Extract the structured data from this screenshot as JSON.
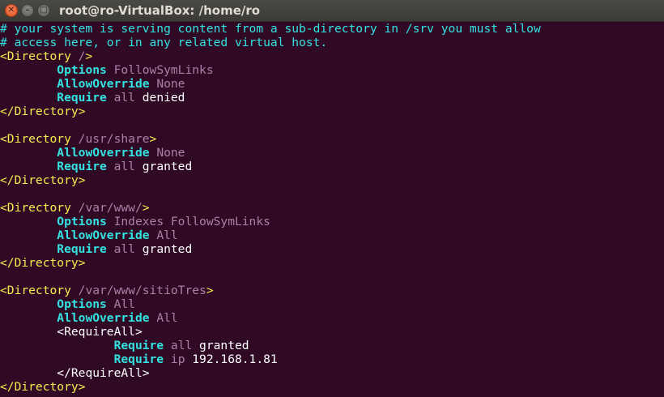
{
  "window": {
    "title": "root@ro-VirtualBox: /home/ro",
    "close_glyph": "✕",
    "minimize_glyph": "–",
    "maximize_glyph": "□"
  },
  "terminal": {
    "lines": [
      {
        "indent": "",
        "parts": [
          {
            "cls": "c",
            "text": "# your system is serving content from a sub-directory in /srv you must allow"
          }
        ]
      },
      {
        "indent": "",
        "parts": [
          {
            "cls": "c",
            "text": "# access here, or in any related virtual host."
          }
        ]
      },
      {
        "indent": "",
        "parts": [
          {
            "cls": "t",
            "text": "<Directory "
          },
          {
            "cls": "p",
            "text": "/"
          },
          {
            "cls": "t",
            "text": ">"
          }
        ]
      },
      {
        "indent": "        ",
        "parts": [
          {
            "cls": "k",
            "text": "Options"
          },
          {
            "cls": "w",
            "text": " "
          },
          {
            "cls": "p",
            "text": "FollowSymLinks"
          }
        ]
      },
      {
        "indent": "        ",
        "parts": [
          {
            "cls": "k",
            "text": "AllowOverride"
          },
          {
            "cls": "w",
            "text": " "
          },
          {
            "cls": "p",
            "text": "None"
          }
        ]
      },
      {
        "indent": "        ",
        "parts": [
          {
            "cls": "k",
            "text": "Require"
          },
          {
            "cls": "w",
            "text": " "
          },
          {
            "cls": "p",
            "text": "all"
          },
          {
            "cls": "w",
            "text": " denied"
          }
        ]
      },
      {
        "indent": "",
        "parts": [
          {
            "cls": "t",
            "text": "</Directory>"
          }
        ]
      },
      {
        "indent": "",
        "parts": []
      },
      {
        "indent": "",
        "parts": [
          {
            "cls": "t",
            "text": "<Directory "
          },
          {
            "cls": "p",
            "text": "/usr/share"
          },
          {
            "cls": "t",
            "text": ">"
          }
        ]
      },
      {
        "indent": "        ",
        "parts": [
          {
            "cls": "k",
            "text": "AllowOverride"
          },
          {
            "cls": "w",
            "text": " "
          },
          {
            "cls": "p",
            "text": "None"
          }
        ]
      },
      {
        "indent": "        ",
        "parts": [
          {
            "cls": "k",
            "text": "Require"
          },
          {
            "cls": "w",
            "text": " "
          },
          {
            "cls": "p",
            "text": "all"
          },
          {
            "cls": "w",
            "text": " granted"
          }
        ]
      },
      {
        "indent": "",
        "parts": [
          {
            "cls": "t",
            "text": "</Directory>"
          }
        ]
      },
      {
        "indent": "",
        "parts": []
      },
      {
        "indent": "",
        "parts": [
          {
            "cls": "t",
            "text": "<Directory "
          },
          {
            "cls": "p",
            "text": "/var/www/"
          },
          {
            "cls": "t",
            "text": ">"
          }
        ]
      },
      {
        "indent": "        ",
        "parts": [
          {
            "cls": "k",
            "text": "Options"
          },
          {
            "cls": "w",
            "text": " "
          },
          {
            "cls": "p",
            "text": "Indexes FollowSymLinks"
          }
        ]
      },
      {
        "indent": "        ",
        "parts": [
          {
            "cls": "k",
            "text": "AllowOverride"
          },
          {
            "cls": "w",
            "text": " "
          },
          {
            "cls": "p",
            "text": "All"
          }
        ]
      },
      {
        "indent": "        ",
        "parts": [
          {
            "cls": "k",
            "text": "Require"
          },
          {
            "cls": "w",
            "text": " "
          },
          {
            "cls": "p",
            "text": "all"
          },
          {
            "cls": "w",
            "text": " granted"
          }
        ]
      },
      {
        "indent": "",
        "parts": [
          {
            "cls": "t",
            "text": "</Directory>"
          }
        ]
      },
      {
        "indent": "",
        "parts": []
      },
      {
        "indent": "",
        "parts": [
          {
            "cls": "t",
            "text": "<Directory "
          },
          {
            "cls": "p",
            "text": "/var/www/sitioTres"
          },
          {
            "cls": "t",
            "text": ">"
          }
        ]
      },
      {
        "indent": "        ",
        "parts": [
          {
            "cls": "k",
            "text": "Options"
          },
          {
            "cls": "w",
            "text": " "
          },
          {
            "cls": "p",
            "text": "All"
          }
        ]
      },
      {
        "indent": "        ",
        "parts": [
          {
            "cls": "k",
            "text": "AllowOverride"
          },
          {
            "cls": "w",
            "text": " "
          },
          {
            "cls": "p",
            "text": "All"
          }
        ]
      },
      {
        "indent": "        ",
        "parts": [
          {
            "cls": "w",
            "text": "<RequireAll>"
          }
        ]
      },
      {
        "indent": "                ",
        "parts": [
          {
            "cls": "k",
            "text": "Require"
          },
          {
            "cls": "w",
            "text": " "
          },
          {
            "cls": "p",
            "text": "all"
          },
          {
            "cls": "w",
            "text": " granted"
          }
        ]
      },
      {
        "indent": "                ",
        "parts": [
          {
            "cls": "k",
            "text": "Require"
          },
          {
            "cls": "w",
            "text": " "
          },
          {
            "cls": "p",
            "text": "ip"
          },
          {
            "cls": "w",
            "text": " 192.168.1.81"
          }
        ]
      },
      {
        "indent": "        ",
        "parts": [
          {
            "cls": "w",
            "text": "</RequireAll>"
          }
        ]
      },
      {
        "indent": "",
        "parts": [
          {
            "cls": "t",
            "text": "</Directory>"
          }
        ]
      }
    ]
  },
  "colors": {
    "background": "#300a24",
    "comment": "#34e2e2",
    "tag": "#fce94f",
    "value": "#ad7fa8",
    "keyword": "#34e2e2",
    "text": "#ffffff"
  }
}
